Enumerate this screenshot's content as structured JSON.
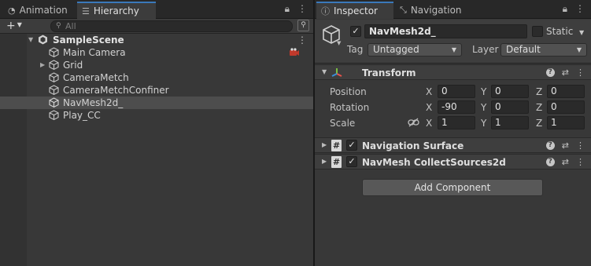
{
  "left_tabs": [
    {
      "label": "Animation",
      "icon": "animation-icon",
      "active": false
    },
    {
      "label": "Hierarchy",
      "icon": "hierarchy-icon",
      "active": true
    }
  ],
  "hierarchy": {
    "search_placeholder": "All",
    "scene": "SampleScene",
    "items": [
      {
        "label": "Main Camera",
        "expandable": false,
        "selected": false
      },
      {
        "label": "Grid",
        "expandable": true,
        "selected": false
      },
      {
        "label": "CameraMetch",
        "expandable": false,
        "selected": false
      },
      {
        "label": "CameraMetchConfiner",
        "expandable": false,
        "selected": false
      },
      {
        "label": "NavMesh2d_",
        "expandable": false,
        "selected": true
      },
      {
        "label": "Play_CC",
        "expandable": false,
        "selected": false
      }
    ]
  },
  "right_tabs": [
    {
      "label": "Inspector",
      "icon": "info-icon",
      "active": true
    },
    {
      "label": "Navigation",
      "icon": "navigation-icon",
      "active": false
    }
  ],
  "inspector": {
    "object_name": "NavMesh2d_",
    "active_checked": true,
    "static_label": "Static",
    "static_checked": false,
    "tag_label": "Tag",
    "tag_value": "Untagged",
    "layer_label": "Layer",
    "layer_value": "Default",
    "transform": {
      "title": "Transform",
      "rows": [
        {
          "label": "Position",
          "x": "0",
          "y": "0",
          "z": "0"
        },
        {
          "label": "Rotation",
          "x": "-90",
          "y": "0",
          "z": "0"
        },
        {
          "label": "Scale",
          "x": "1",
          "y": "1",
          "z": "1"
        }
      ],
      "axis_x": "X",
      "axis_y": "Y",
      "axis_z": "Z"
    },
    "components": [
      {
        "title": "Navigation Surface",
        "checked": true
      },
      {
        "title": "NavMesh CollectSources2d",
        "checked": true
      }
    ],
    "add_component": "Add Component"
  },
  "colors": {
    "panel": "#383838",
    "tab_bar": "#282828",
    "accent": "#3a79bb",
    "selection": "#4d4d4d"
  }
}
